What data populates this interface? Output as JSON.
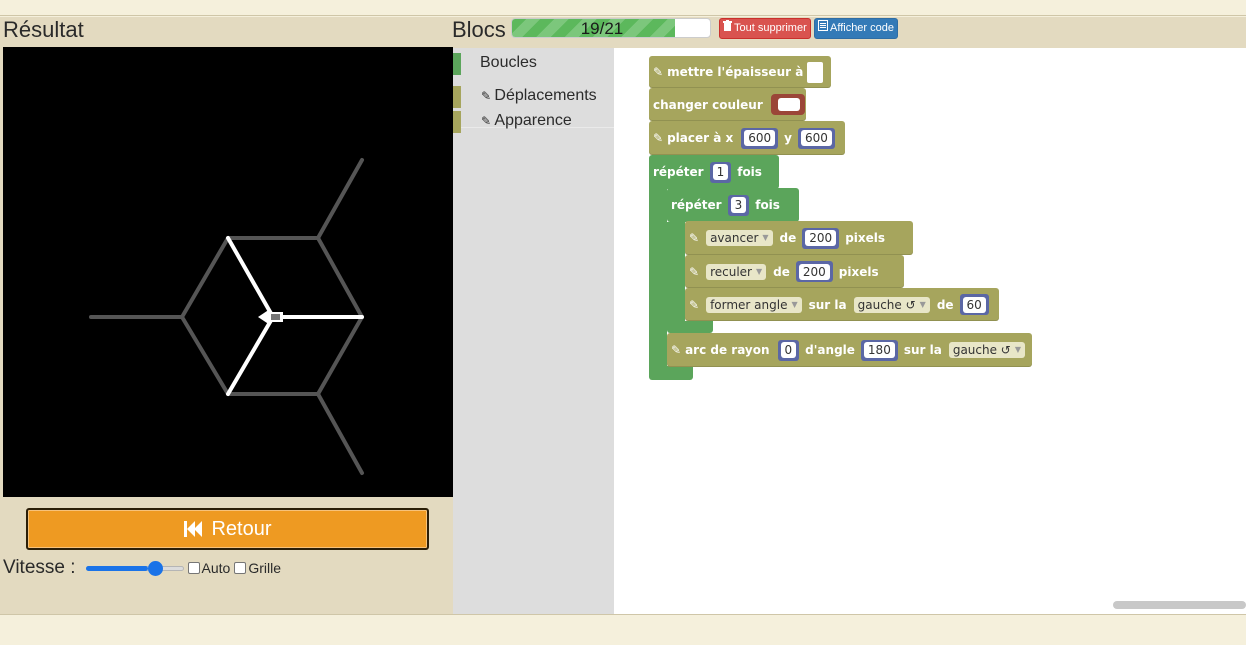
{
  "panels": {
    "result_title": "Résultat",
    "blocks_title": "Blocs"
  },
  "progress": {
    "text": "19/21",
    "value": 19,
    "max": 21
  },
  "buttons": {
    "delete_all": "Tout supprimer",
    "show_code": "Afficher code",
    "retour": "Retour"
  },
  "controls": {
    "speed_label": "Vitesse :",
    "speed_fraction": 0.75,
    "auto_label": "Auto",
    "grid_label": "Grille",
    "auto_checked": false,
    "grid_checked": false
  },
  "toolbox": {
    "items": [
      {
        "label": "Boucles",
        "color": "#5ba55b",
        "icon": ""
      },
      {
        "label": "Déplacements",
        "color": "#a6a55d",
        "icon": "pencil-icon"
      },
      {
        "label": "Apparence",
        "color": "#a6a55d",
        "icon": "pencil-icon"
      }
    ]
  },
  "program": {
    "set_width": "mettre l'épaisseur à",
    "change_color": "changer couleur",
    "place_at_x": "placer à x",
    "place_x": "600",
    "place_y_label": "y",
    "place_y": "600",
    "repeat_outer_label": "répéter",
    "repeat_outer": "1",
    "times_label": "fois",
    "repeat_inner_label": "répéter",
    "repeat_inner": "3",
    "move_action": "avancer",
    "move_of": "de",
    "move_value": "200",
    "pixels": "pixels",
    "back_action": "reculer",
    "back_of": "de",
    "back_value": "200",
    "turn_action": "former angle",
    "turn_side_label": "sur la",
    "turn_side": "gauche ↺",
    "turn_of": "de",
    "turn_value": "60",
    "arc_label": "arc de rayon",
    "arc_radius": "0",
    "arc_angle_label": "d'angle",
    "arc_angle": "180",
    "arc_side_label": "sur la",
    "arc_side": "gauche ↺"
  },
  "colors": {
    "motion_block": "#a6a55d",
    "loop_block": "#5ba55b",
    "value_slot": "#5b67a5",
    "retour_button": "#ee9a22",
    "delete_button": "#d9534f",
    "code_button": "#337ab7"
  }
}
